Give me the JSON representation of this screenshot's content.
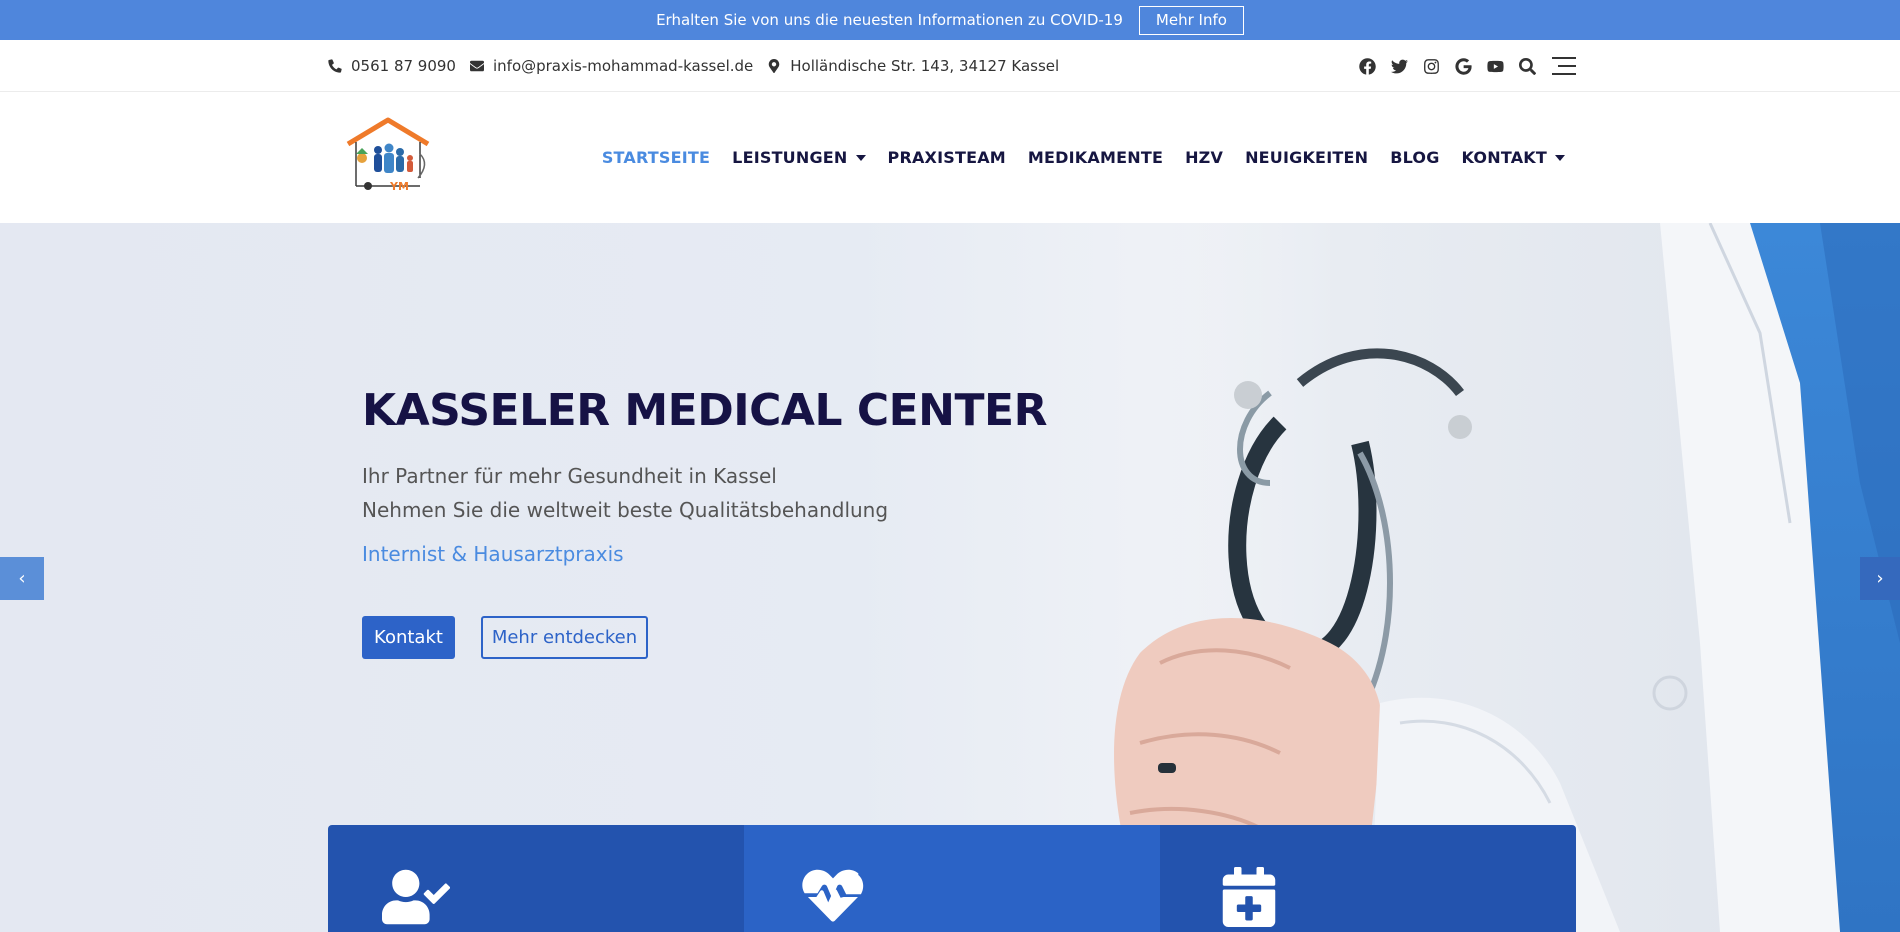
{
  "announcement": {
    "text": "Erhalten Sie von uns die neuesten Informationen zu COVID-19",
    "button_label": "Mehr Info"
  },
  "contact": {
    "phone": "0561 87 9090",
    "email": "info@praxis-mohammad-kassel.de",
    "address": "Holländische Str. 143, 34127 Kassel"
  },
  "social_icons": [
    "facebook-icon",
    "twitter-icon",
    "instagram-icon",
    "google-icon",
    "youtube-icon",
    "search-icon",
    "menu-icon"
  ],
  "logo": {
    "letters": "YM"
  },
  "nav": {
    "items": [
      {
        "label": "STARTSEITE",
        "active": true
      },
      {
        "label": "LEISTUNGEN",
        "dropdown": true
      },
      {
        "label": "PRAXISTEAM"
      },
      {
        "label": "MEDIKAMENTE"
      },
      {
        "label": "HZV"
      },
      {
        "label": "NEUIGKEITEN"
      },
      {
        "label": "BLOG"
      },
      {
        "label": "KONTAKT",
        "dropdown": true
      }
    ]
  },
  "hero": {
    "title": "KASSELER MEDICAL CENTER",
    "line1": "Ihr Partner für mehr Gesundheit in Kassel",
    "line2": "Nehmen Sie die weltweit beste Qualitätsbehandlung",
    "subtitle": "Internist & Hausarztpraxis",
    "primary_button": "Kontakt",
    "secondary_button": "Mehr entdecken",
    "prev_arrow": "‹",
    "next_arrow": "›"
  },
  "features": {
    "icons": [
      "user-check-icon",
      "heartbeat-icon",
      "calendar-plus-icon"
    ]
  },
  "colors": {
    "announce_bg": "#4f86dc",
    "accent": "#4a8be0",
    "primary": "#2d63c8",
    "nav_text": "#161641",
    "feature_dark": "#2353ae",
    "feature_light": "#2b63c6"
  }
}
